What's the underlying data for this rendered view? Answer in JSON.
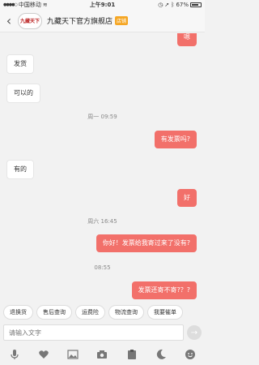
{
  "status_bar": {
    "carrier": "中国移动",
    "time": "上午9:01",
    "battery": "67%"
  },
  "header": {
    "shop_logo_text": "九藏天下",
    "shop_name": "九藏天下官方旗舰店",
    "badge": "店铺"
  },
  "messages": [
    {
      "side": "right",
      "text": "嗯"
    },
    {
      "side": "left",
      "text": "发货"
    },
    {
      "side": "left",
      "text": "可以的"
    },
    {
      "time": "周一 09:59"
    },
    {
      "side": "right",
      "text": "有发票吗?"
    },
    {
      "side": "left",
      "text": "有的"
    },
    {
      "side": "right",
      "text": "好"
    },
    {
      "time": "周六 16:45"
    },
    {
      "side": "right",
      "text": "你好！发票给我寄过来了没有?"
    },
    {
      "time": "08:55"
    },
    {
      "side": "right",
      "text": "发票还寄不寄?？?"
    }
  ],
  "quick_replies": [
    "退换货",
    "售后查询",
    "运费险",
    "物流查询",
    "我要催单"
  ],
  "input": {
    "placeholder": "请输入文字"
  },
  "toolbar": [
    "microphone-icon",
    "heart-icon",
    "image-icon",
    "camera-icon",
    "clipboard-icon",
    "moon-icon",
    "emoji-icon"
  ],
  "colors": {
    "accent": "#f2706a",
    "badge": "#f5a623"
  }
}
